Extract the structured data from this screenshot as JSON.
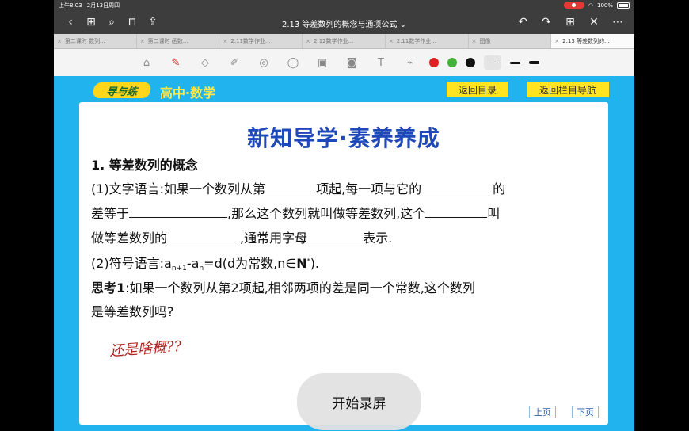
{
  "status_bar": {
    "time": "上午8:03",
    "date": "2月13日周四",
    "battery": "100%"
  },
  "title_bar": {
    "title": "2.13 等差数列的概念与通项公式",
    "chevron": "⌄"
  },
  "tabs": [
    "第二课时 数列...",
    "第二课时 函数...",
    "2.11数学作业...",
    "2.12数学作业...",
    "2.11数学作业...",
    "图像",
    "2.13 等差数列的..."
  ],
  "toolbar": {
    "pen_colors": [
      "#e02020",
      "#41b335",
      "#111111"
    ]
  },
  "slide": {
    "logo_text": "导与练",
    "subject": "高中·数学",
    "btn_back_catalog": "返回目录",
    "btn_back_nav": "返回栏目导航",
    "heading": "新知导学·素养养成",
    "section_title": "1. 等差数列的概念",
    "line1_a": "(1)文字语言:如果一个数列从第",
    "line1_b": "项起,每一项与它的",
    "line1_c": "的",
    "line2_a": "差等于",
    "line2_b": ",那么这个数列就叫做等差数列,这个",
    "line2_c": "叫",
    "line3_a": "做等差数列的",
    "line3_b": ",通常用字母",
    "line3_c": "表示.",
    "formula_prefix": "(2)符号语言:a",
    "formula_sub1": "n+1",
    "formula_mid": "-a",
    "formula_sub2": "n",
    "formula_rest": "=d(d为常数,n∈",
    "formula_set": "N",
    "formula_sup": "*",
    "formula_end": ").",
    "think_label": "思考1",
    "think_text1": ":如果一个数列从第2项起,相邻两项的差是同一个常数,这个数列",
    "think_text2": "是等差数列吗?",
    "handwriting": "还是啥概??",
    "overlay": "开始录屏",
    "prev_page": "上页",
    "next_page": "下页"
  }
}
